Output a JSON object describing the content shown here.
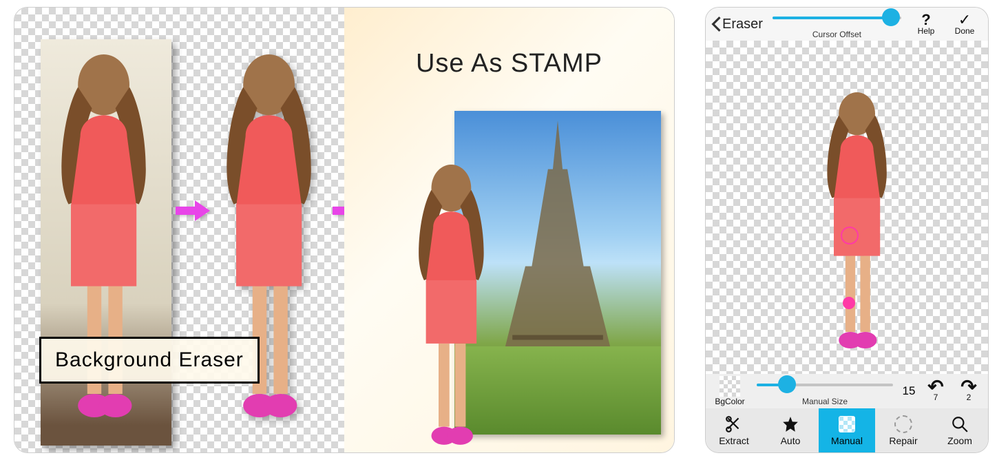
{
  "promo": {
    "title": "Background Eraser",
    "stamp_heading": "Use As STAMP"
  },
  "topbar": {
    "back_label": "Eraser",
    "slider_label": "Cursor Offset",
    "slider_pct": 92,
    "help_label": "Help",
    "done_label": "Done"
  },
  "midbar": {
    "bgcolor_label": "BgColor",
    "size_label": "Manual Size",
    "size_value": "15",
    "size_pct": 22,
    "undo_count": "7",
    "redo_count": "2"
  },
  "tabs": {
    "extract": "Extract",
    "auto": "Auto",
    "manual": "Manual",
    "repair": "Repair",
    "zoom": "Zoom",
    "active": "manual"
  }
}
